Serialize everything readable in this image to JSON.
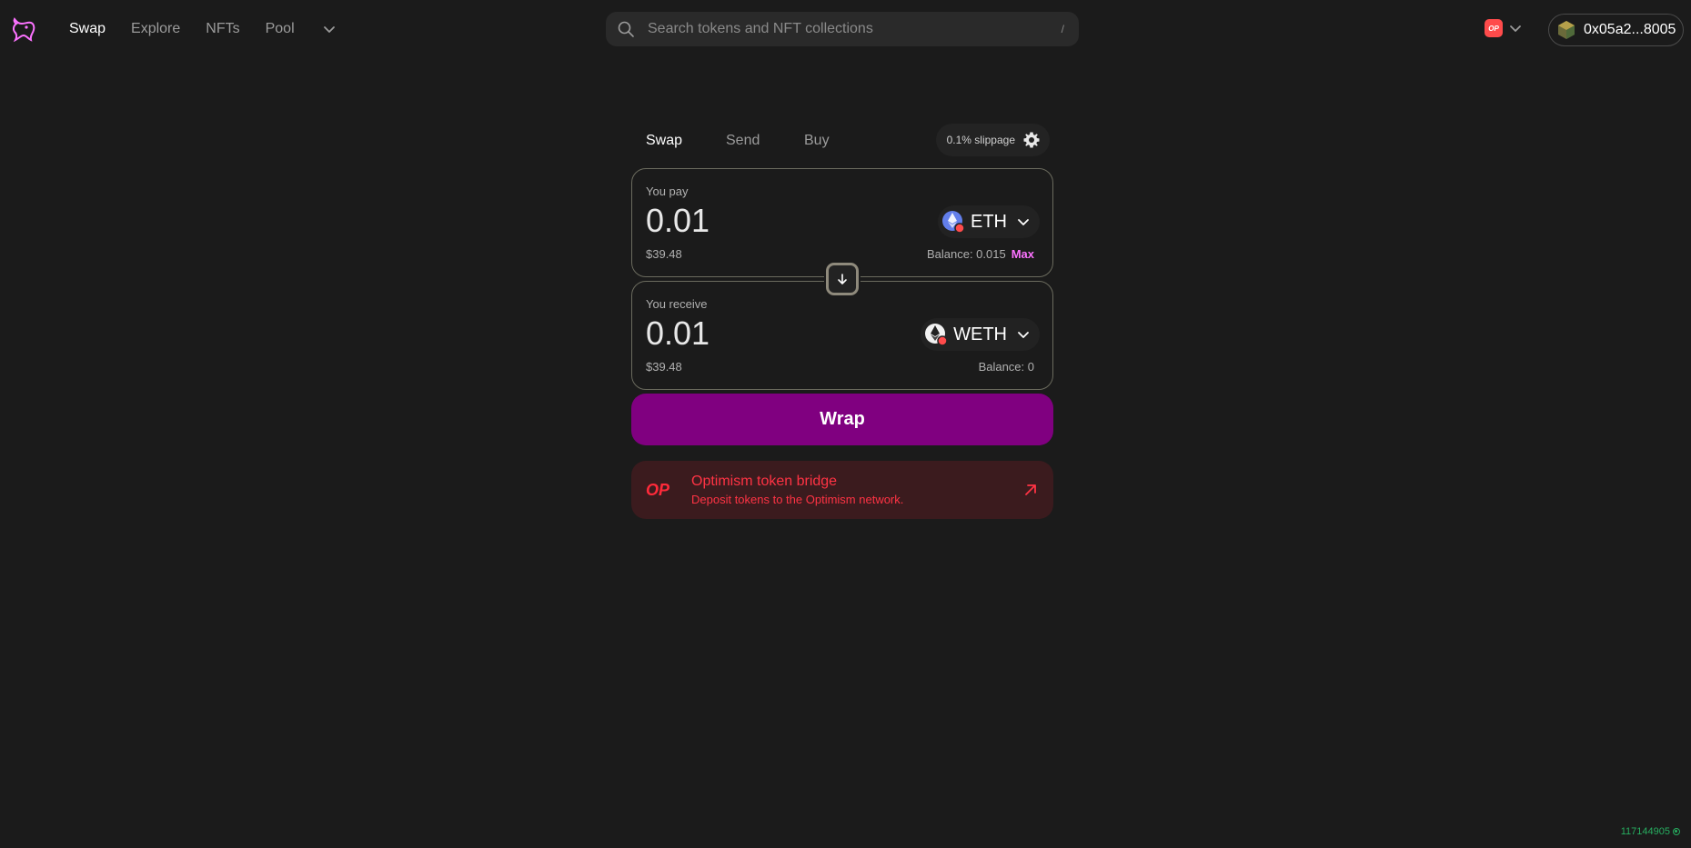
{
  "nav": {
    "links": [
      "Swap",
      "Explore",
      "NFTs",
      "Pool"
    ],
    "active_index": 0
  },
  "search": {
    "placeholder": "Search tokens and NFT collections",
    "shortcut": "/"
  },
  "chain": {
    "badge": "OP"
  },
  "wallet": {
    "address": "0x05a2...8005"
  },
  "swap": {
    "tabs": [
      "Swap",
      "Send",
      "Buy"
    ],
    "slippage": "0.1% slippage",
    "pay": {
      "label": "You pay",
      "amount": "0.01",
      "fiat": "$39.48",
      "token": "ETH",
      "balance": "Balance: 0.015",
      "max_label": "Max"
    },
    "receive": {
      "label": "You receive",
      "amount": "0.01",
      "fiat": "$39.48",
      "token": "WETH",
      "balance": "Balance: 0"
    },
    "action_label": "Wrap"
  },
  "bridge": {
    "logo": "OP",
    "title": "Optimism token bridge",
    "subtitle": "Deposit tokens to the Optimism network."
  },
  "status": {
    "block_number": "117144905"
  },
  "colors": {
    "accent_pink": "#fc72ff",
    "wrap_button": "#800080",
    "bridge_red": "#ff3344",
    "bridge_bg": "#3b1b1e",
    "block_green": "#27ae60"
  }
}
